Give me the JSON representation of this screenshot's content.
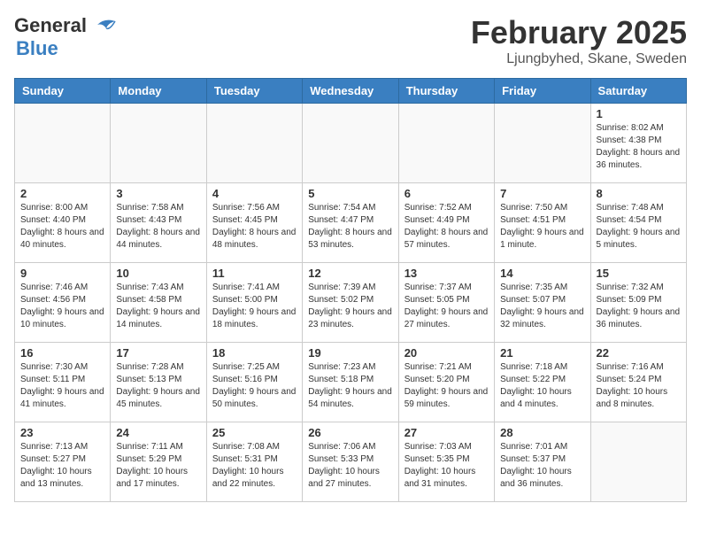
{
  "logo": {
    "general": "General",
    "blue": "Blue"
  },
  "title": "February 2025",
  "subtitle": "Ljungbyhed, Skane, Sweden",
  "days_of_week": [
    "Sunday",
    "Monday",
    "Tuesday",
    "Wednesday",
    "Thursday",
    "Friday",
    "Saturday"
  ],
  "weeks": [
    [
      {
        "day": "",
        "details": ""
      },
      {
        "day": "",
        "details": ""
      },
      {
        "day": "",
        "details": ""
      },
      {
        "day": "",
        "details": ""
      },
      {
        "day": "",
        "details": ""
      },
      {
        "day": "",
        "details": ""
      },
      {
        "day": "1",
        "details": "Sunrise: 8:02 AM\nSunset: 4:38 PM\nDaylight: 8 hours and 36 minutes."
      }
    ],
    [
      {
        "day": "2",
        "details": "Sunrise: 8:00 AM\nSunset: 4:40 PM\nDaylight: 8 hours and 40 minutes."
      },
      {
        "day": "3",
        "details": "Sunrise: 7:58 AM\nSunset: 4:43 PM\nDaylight: 8 hours and 44 minutes."
      },
      {
        "day": "4",
        "details": "Sunrise: 7:56 AM\nSunset: 4:45 PM\nDaylight: 8 hours and 48 minutes."
      },
      {
        "day": "5",
        "details": "Sunrise: 7:54 AM\nSunset: 4:47 PM\nDaylight: 8 hours and 53 minutes."
      },
      {
        "day": "6",
        "details": "Sunrise: 7:52 AM\nSunset: 4:49 PM\nDaylight: 8 hours and 57 minutes."
      },
      {
        "day": "7",
        "details": "Sunrise: 7:50 AM\nSunset: 4:51 PM\nDaylight: 9 hours and 1 minute."
      },
      {
        "day": "8",
        "details": "Sunrise: 7:48 AM\nSunset: 4:54 PM\nDaylight: 9 hours and 5 minutes."
      }
    ],
    [
      {
        "day": "9",
        "details": "Sunrise: 7:46 AM\nSunset: 4:56 PM\nDaylight: 9 hours and 10 minutes."
      },
      {
        "day": "10",
        "details": "Sunrise: 7:43 AM\nSunset: 4:58 PM\nDaylight: 9 hours and 14 minutes."
      },
      {
        "day": "11",
        "details": "Sunrise: 7:41 AM\nSunset: 5:00 PM\nDaylight: 9 hours and 18 minutes."
      },
      {
        "day": "12",
        "details": "Sunrise: 7:39 AM\nSunset: 5:02 PM\nDaylight: 9 hours and 23 minutes."
      },
      {
        "day": "13",
        "details": "Sunrise: 7:37 AM\nSunset: 5:05 PM\nDaylight: 9 hours and 27 minutes."
      },
      {
        "day": "14",
        "details": "Sunrise: 7:35 AM\nSunset: 5:07 PM\nDaylight: 9 hours and 32 minutes."
      },
      {
        "day": "15",
        "details": "Sunrise: 7:32 AM\nSunset: 5:09 PM\nDaylight: 9 hours and 36 minutes."
      }
    ],
    [
      {
        "day": "16",
        "details": "Sunrise: 7:30 AM\nSunset: 5:11 PM\nDaylight: 9 hours and 41 minutes."
      },
      {
        "day": "17",
        "details": "Sunrise: 7:28 AM\nSunset: 5:13 PM\nDaylight: 9 hours and 45 minutes."
      },
      {
        "day": "18",
        "details": "Sunrise: 7:25 AM\nSunset: 5:16 PM\nDaylight: 9 hours and 50 minutes."
      },
      {
        "day": "19",
        "details": "Sunrise: 7:23 AM\nSunset: 5:18 PM\nDaylight: 9 hours and 54 minutes."
      },
      {
        "day": "20",
        "details": "Sunrise: 7:21 AM\nSunset: 5:20 PM\nDaylight: 9 hours and 59 minutes."
      },
      {
        "day": "21",
        "details": "Sunrise: 7:18 AM\nSunset: 5:22 PM\nDaylight: 10 hours and 4 minutes."
      },
      {
        "day": "22",
        "details": "Sunrise: 7:16 AM\nSunset: 5:24 PM\nDaylight: 10 hours and 8 minutes."
      }
    ],
    [
      {
        "day": "23",
        "details": "Sunrise: 7:13 AM\nSunset: 5:27 PM\nDaylight: 10 hours and 13 minutes."
      },
      {
        "day": "24",
        "details": "Sunrise: 7:11 AM\nSunset: 5:29 PM\nDaylight: 10 hours and 17 minutes."
      },
      {
        "day": "25",
        "details": "Sunrise: 7:08 AM\nSunset: 5:31 PM\nDaylight: 10 hours and 22 minutes."
      },
      {
        "day": "26",
        "details": "Sunrise: 7:06 AM\nSunset: 5:33 PM\nDaylight: 10 hours and 27 minutes."
      },
      {
        "day": "27",
        "details": "Sunrise: 7:03 AM\nSunset: 5:35 PM\nDaylight: 10 hours and 31 minutes."
      },
      {
        "day": "28",
        "details": "Sunrise: 7:01 AM\nSunset: 5:37 PM\nDaylight: 10 hours and 36 minutes."
      },
      {
        "day": "",
        "details": ""
      }
    ]
  ]
}
